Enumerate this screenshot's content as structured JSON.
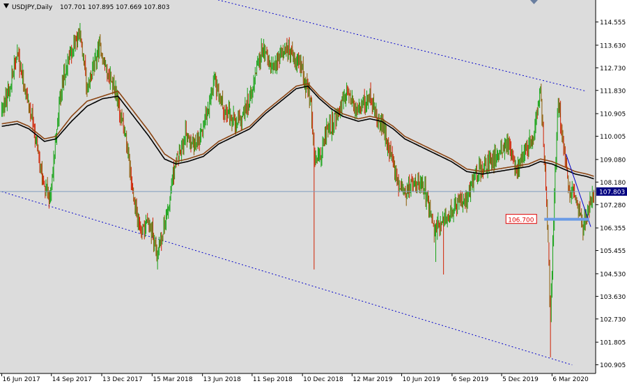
{
  "window": {
    "symbol_title": "USDJPY,Daily",
    "ohlc_text": "107.701 107.895 107.669 107.803"
  },
  "colors": {
    "background": "#dcdcdc",
    "candle_up": "#16a316",
    "candle_down": "#d02000",
    "candle_neutral": "#8a5a00",
    "ma_fast": "#000000",
    "ma_slow": "#8b4513",
    "channel": "#0000cc",
    "trendline": "#0000cc",
    "support_zone": "#6a9be6",
    "price_line": "#7f9bbf",
    "price_label_bg": "#000080",
    "annotation_border": "#e00000",
    "annotation_text": "#e00000"
  },
  "chart_data": {
    "type": "candlestick",
    "symbol": "USDJPY",
    "timeframe": "Daily",
    "current_price": "107.803",
    "ylim": [
      100.56,
      115.43
    ],
    "y_ticks": [
      "114.555",
      "113.630",
      "112.730",
      "111.830",
      "110.905",
      "110.005",
      "109.080",
      "108.180",
      "107.280",
      "106.355",
      "105.455",
      "104.530",
      "103.630",
      "102.730",
      "101.805",
      "100.905"
    ],
    "x_ticks": [
      "16 Jun 2017",
      "14 Sep 2017",
      "13 Dec 2017",
      "15 Mar 2018",
      "13 Jun 2018",
      "11 Sep 2018",
      "10 Dec 2018",
      "12 Mar 2019",
      "10 Jun 2019",
      "6 Sep 2019",
      "5 Dec 2019",
      "6 Mar 2020"
    ],
    "x_tick_index": [
      0,
      64,
      129,
      194,
      259,
      323,
      388,
      452,
      516,
      581,
      645,
      710
    ],
    "bar_count": 765,
    "price_path": [
      [
        0,
        111.0
      ],
      [
        10,
        112.0
      ],
      [
        20,
        113.3
      ],
      [
        40,
        110.5
      ],
      [
        55,
        108.0
      ],
      [
        62,
        107.5
      ],
      [
        75,
        111.6
      ],
      [
        85,
        113.0
      ],
      [
        100,
        114.2
      ],
      [
        110,
        111.8
      ],
      [
        125,
        113.5
      ],
      [
        145,
        112.0
      ],
      [
        160,
        110.0
      ],
      [
        170,
        107.5
      ],
      [
        180,
        106.2
      ],
      [
        190,
        106.7
      ],
      [
        200,
        105.2
      ],
      [
        215,
        107.2
      ],
      [
        225,
        109.2
      ],
      [
        238,
        110.0
      ],
      [
        250,
        109.6
      ],
      [
        262,
        110.5
      ],
      [
        275,
        112.3
      ],
      [
        290,
        110.9
      ],
      [
        305,
        110.5
      ],
      [
        320,
        111.5
      ],
      [
        335,
        113.4
      ],
      [
        350,
        112.8
      ],
      [
        365,
        113.6
      ],
      [
        385,
        112.9
      ],
      [
        398,
        111.5
      ],
      [
        404,
        109.0
      ],
      [
        412,
        109.4
      ],
      [
        420,
        110.2
      ],
      [
        432,
        110.8
      ],
      [
        445,
        111.6
      ],
      [
        460,
        111.0
      ],
      [
        475,
        111.5
      ],
      [
        488,
        110.5
      ],
      [
        500,
        109.5
      ],
      [
        512,
        108.0
      ],
      [
        522,
        107.8
      ],
      [
        530,
        108.2
      ],
      [
        545,
        108.0
      ],
      [
        558,
        106.4
      ],
      [
        568,
        106.6
      ],
      [
        578,
        106.9
      ],
      [
        590,
        107.4
      ],
      [
        600,
        107.5
      ],
      [
        610,
        108.5
      ],
      [
        625,
        108.9
      ],
      [
        640,
        109.2
      ],
      [
        655,
        109.6
      ],
      [
        665,
        108.6
      ],
      [
        675,
        109.5
      ],
      [
        685,
        109.8
      ],
      [
        695,
        111.9
      ],
      [
        700,
        109.2
      ],
      [
        705,
        106.0
      ],
      [
        708,
        102.5
      ],
      [
        712,
        107.0
      ],
      [
        718,
        111.4
      ],
      [
        725,
        109.5
      ],
      [
        732,
        108.0
      ],
      [
        742,
        107.3
      ],
      [
        750,
        106.5
      ],
      [
        758,
        107.1
      ],
      [
        765,
        107.8
      ]
    ],
    "price_spikes": [
      {
        "index": 62,
        "low": 107.3
      },
      {
        "index": 201,
        "low": 104.7
      },
      {
        "index": 403,
        "low": 104.7
      },
      {
        "index": 560,
        "low": 105.0
      },
      {
        "index": 570,
        "low": 104.5
      },
      {
        "index": 708,
        "low": 101.2
      },
      {
        "index": 696,
        "high": 112.1
      }
    ],
    "indicators": [
      {
        "type": "moving_average",
        "role": "fast",
        "points": [
          [
            0,
            110.4
          ],
          [
            20,
            110.5
          ],
          [
            35,
            110.3
          ],
          [
            55,
            109.8
          ],
          [
            70,
            109.9
          ],
          [
            90,
            110.6
          ],
          [
            110,
            111.2
          ],
          [
            130,
            111.5
          ],
          [
            150,
            111.6
          ],
          [
            170,
            110.8
          ],
          [
            190,
            110.0
          ],
          [
            210,
            109.1
          ],
          [
            225,
            108.9
          ],
          [
            240,
            109.0
          ],
          [
            260,
            109.2
          ],
          [
            280,
            109.7
          ],
          [
            300,
            110.0
          ],
          [
            320,
            110.3
          ],
          [
            340,
            110.9
          ],
          [
            360,
            111.4
          ],
          [
            380,
            111.9
          ],
          [
            395,
            112.0
          ],
          [
            410,
            111.5
          ],
          [
            425,
            111.1
          ],
          [
            440,
            110.8
          ],
          [
            460,
            110.6
          ],
          [
            475,
            110.7
          ],
          [
            490,
            110.6
          ],
          [
            505,
            110.3
          ],
          [
            520,
            109.9
          ],
          [
            540,
            109.6
          ],
          [
            560,
            109.3
          ],
          [
            580,
            109.0
          ],
          [
            600,
            108.6
          ],
          [
            620,
            108.5
          ],
          [
            640,
            108.6
          ],
          [
            660,
            108.7
          ],
          [
            680,
            108.8
          ],
          [
            695,
            109.0
          ],
          [
            710,
            108.9
          ],
          [
            725,
            108.7
          ],
          [
            740,
            108.5
          ],
          [
            755,
            108.4
          ],
          [
            765,
            108.3
          ]
        ]
      },
      {
        "type": "moving_average",
        "role": "slow",
        "points": [
          [
            0,
            110.5
          ],
          [
            20,
            110.6
          ],
          [
            35,
            110.4
          ],
          [
            55,
            109.9
          ],
          [
            70,
            110.0
          ],
          [
            90,
            110.8
          ],
          [
            110,
            111.4
          ],
          [
            130,
            111.6
          ],
          [
            150,
            111.8
          ],
          [
            170,
            111.0
          ],
          [
            190,
            110.2
          ],
          [
            210,
            109.3
          ],
          [
            225,
            109.0
          ],
          [
            240,
            109.1
          ],
          [
            260,
            109.3
          ],
          [
            280,
            109.8
          ],
          [
            300,
            110.1
          ],
          [
            320,
            110.4
          ],
          [
            340,
            111.0
          ],
          [
            360,
            111.5
          ],
          [
            380,
            112.0
          ],
          [
            395,
            112.1
          ],
          [
            410,
            111.6
          ],
          [
            425,
            111.2
          ],
          [
            440,
            110.9
          ],
          [
            460,
            110.7
          ],
          [
            475,
            110.8
          ],
          [
            490,
            110.7
          ],
          [
            505,
            110.4
          ],
          [
            520,
            110.0
          ],
          [
            540,
            109.7
          ],
          [
            560,
            109.4
          ],
          [
            580,
            109.1
          ],
          [
            600,
            108.7
          ],
          [
            620,
            108.6
          ],
          [
            640,
            108.7
          ],
          [
            660,
            108.8
          ],
          [
            680,
            108.9
          ],
          [
            695,
            109.1
          ],
          [
            710,
            109.0
          ],
          [
            725,
            108.8
          ],
          [
            740,
            108.6
          ],
          [
            755,
            108.5
          ],
          [
            765,
            108.4
          ]
        ]
      }
    ],
    "channel_lines": [
      {
        "style": "dotted",
        "from": [
          205,
          116.0
        ],
        "to": [
          754,
          111.8
        ]
      },
      {
        "style": "dotted",
        "from": [
          0,
          107.8
        ],
        "to": [
          736,
          100.9
        ]
      }
    ],
    "trendlines": [
      {
        "style": "solid",
        "from": [
          728,
          109.3
        ],
        "to": [
          760,
          106.4
        ]
      }
    ],
    "support_zone": {
      "price": 106.7,
      "from_index": 700,
      "to_index": 758
    },
    "annotations": [
      {
        "text": "106.700"
      }
    ]
  }
}
